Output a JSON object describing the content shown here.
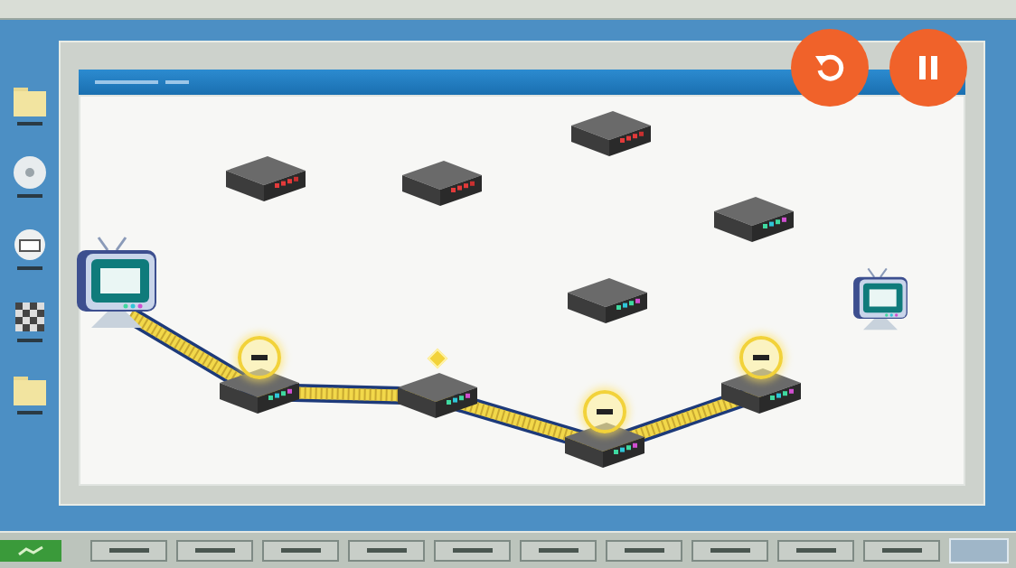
{
  "controls": [
    {
      "kind": "restart"
    },
    {
      "kind": "pause"
    }
  ],
  "network": {
    "nodes": [
      {
        "kind": "computer",
        "role": "source",
        "status": "online",
        "in_path": true,
        "marker": "none"
      },
      {
        "kind": "router",
        "role": "relay",
        "status": "online",
        "in_path": true,
        "marker": "ring"
      },
      {
        "kind": "router",
        "role": "relay",
        "status": "online",
        "in_path": true,
        "marker": "dot"
      },
      {
        "kind": "router",
        "role": "relay",
        "status": "online",
        "in_path": true,
        "marker": "ring"
      },
      {
        "kind": "router",
        "role": "relay",
        "status": "online",
        "in_path": true,
        "marker": "ring"
      },
      {
        "kind": "router",
        "role": "relay",
        "status": "offline",
        "in_path": false,
        "marker": "none"
      },
      {
        "kind": "router",
        "role": "relay",
        "status": "offline",
        "in_path": false,
        "marker": "none"
      },
      {
        "kind": "router",
        "role": "relay",
        "status": "offline",
        "in_path": false,
        "marker": "none"
      },
      {
        "kind": "router",
        "role": "relay",
        "status": "online",
        "in_path": false,
        "marker": "none"
      },
      {
        "kind": "router",
        "role": "relay",
        "status": "online",
        "in_path": false,
        "marker": "none"
      },
      {
        "kind": "computer",
        "role": "target",
        "status": "online",
        "in_path": false,
        "marker": "none"
      }
    ]
  }
}
